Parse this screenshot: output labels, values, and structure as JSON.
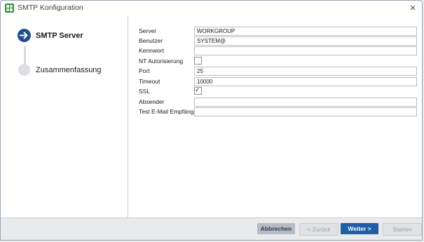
{
  "window": {
    "title": "SMTP Konfiguration",
    "close_label": "✕"
  },
  "steps": [
    {
      "label": "SMTP Server",
      "active": true
    },
    {
      "label": "Zusammenfassung",
      "active": false
    }
  ],
  "form": {
    "server": {
      "label": "Server",
      "value": "WORKGROUP"
    },
    "benutzer": {
      "label": "Benutzer",
      "value": "SYSTEM@"
    },
    "kennwort": {
      "label": "Kennwort",
      "value": ""
    },
    "nt_auth": {
      "label": "NT Autorisierung",
      "checked": false
    },
    "port": {
      "label": "Port",
      "value": "25"
    },
    "timeout": {
      "label": "Timeout",
      "value": "10000"
    },
    "ssl": {
      "label": "SSL",
      "checked": true,
      "mark": "✓"
    },
    "absender": {
      "label": "Absender",
      "value": ""
    },
    "test_email": {
      "label": "Test E-Mail Empfänger",
      "value": ""
    }
  },
  "footer": {
    "cancel_label": "Abbrechen",
    "back_label": "< Zurück",
    "next_label": "Weiter >",
    "finish_label": "Starten"
  },
  "colors": {
    "accent": "#1f5fa8",
    "step_active": "#1f4f8b",
    "step_inactive": "#dcdee1"
  }
}
